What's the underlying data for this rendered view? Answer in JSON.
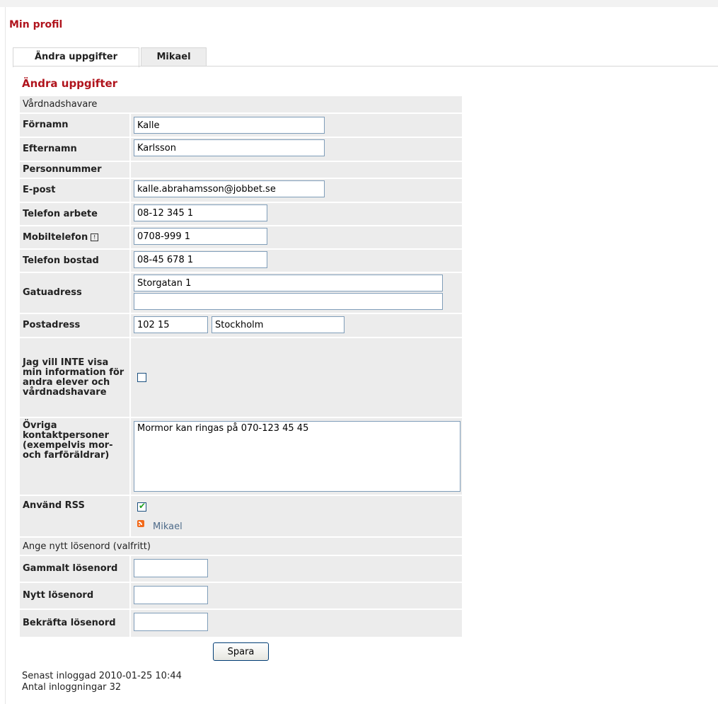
{
  "page_title": "Min profil",
  "tabs": [
    {
      "label": "Ändra uppgifter",
      "active": true
    },
    {
      "label": "Mikael",
      "active": false
    }
  ],
  "section_title": "Ändra uppgifter",
  "guardian_header": "Vårdnadshavare",
  "fields": {
    "fornamn": {
      "label": "Förnamn",
      "value": "Kalle"
    },
    "efternamn": {
      "label": "Efternamn",
      "value": "Karlsson"
    },
    "personnummer": {
      "label": "Personnummer"
    },
    "epost": {
      "label": "E-post",
      "value": "kalle.abrahamsson@jobbet.se"
    },
    "tel_arbete": {
      "label": "Telefon arbete",
      "value": "08-12 345 1"
    },
    "mobil": {
      "label": "Mobiltelefon",
      "value": "0708-999 1",
      "icon": "info-icon"
    },
    "tel_bostad": {
      "label": "Telefon bostad",
      "value": "08-45 678 1"
    },
    "gatuadress": {
      "label": "Gatuadress",
      "value1": "Storgatan 1",
      "value2": ""
    },
    "postadress": {
      "label": "Postadress",
      "postnummer": "102 15",
      "ort": "Stockholm"
    },
    "hide_info": {
      "label": "Jag vill INTE visa min information för andra elever och vårdnadshavare",
      "checked": false
    },
    "ovriga": {
      "label": "Övriga kontaktpersoner (exempelvis mor- och farföräldrar)",
      "value": "Mormor kan ringas på 070-123 45 45"
    },
    "rss": {
      "label": "Använd RSS",
      "checked": true,
      "feed_link": "Mikael"
    }
  },
  "password_header": "Ange nytt lösenord (valfritt)",
  "password_fields": {
    "old": {
      "label": "Gammalt lösenord"
    },
    "new": {
      "label": "Nytt lösenord"
    },
    "confirm": {
      "label": "Bekräfta lösenord"
    }
  },
  "save_label": "Spara",
  "footer": {
    "last_login": "Senast inloggad 2010-01-25 10:44",
    "login_count": "Antal inloggningar 32"
  },
  "colors": {
    "accent": "#b0141d",
    "row_bg": "#ececec",
    "input_border": "#7f9db9",
    "link": "#4e6b8a"
  }
}
